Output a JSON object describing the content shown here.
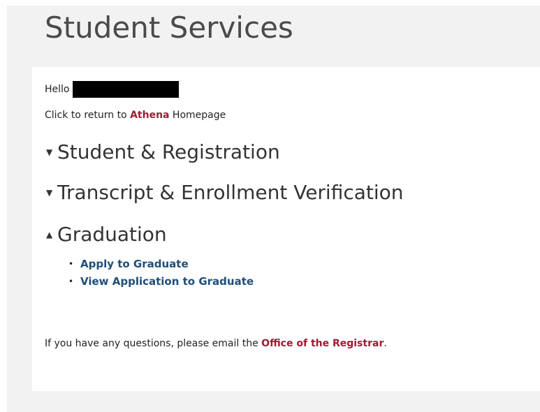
{
  "page": {
    "title": "Student Services"
  },
  "greeting": {
    "label": "Hello"
  },
  "return_line": {
    "prefix": "Click to return to ",
    "link": "Athena",
    "suffix": " Homepage"
  },
  "sections": [
    {
      "arrow": "▼",
      "label": "Student & Registration",
      "state": "collapsed"
    },
    {
      "arrow": "▼",
      "label": "Transcript & Enrollment Verification",
      "state": "collapsed"
    },
    {
      "arrow": "▲",
      "label": "Graduation",
      "state": "expanded"
    }
  ],
  "graduation_links": [
    {
      "bullet": "•",
      "label": "Apply to Graduate"
    },
    {
      "bullet": "•",
      "label": "View Application to Graduate"
    }
  ],
  "footer": {
    "prefix": "If you have any questions, please email the ",
    "link": "Office of the Registrar",
    "suffix": "."
  },
  "colors": {
    "brand_link": "#9e1b32",
    "nav_link": "#1f4e79",
    "background": "#f2f2f2",
    "panel": "#ffffff"
  },
  "icons": {
    "collapsed": "triangle-down-icon",
    "expanded": "triangle-up-icon"
  }
}
